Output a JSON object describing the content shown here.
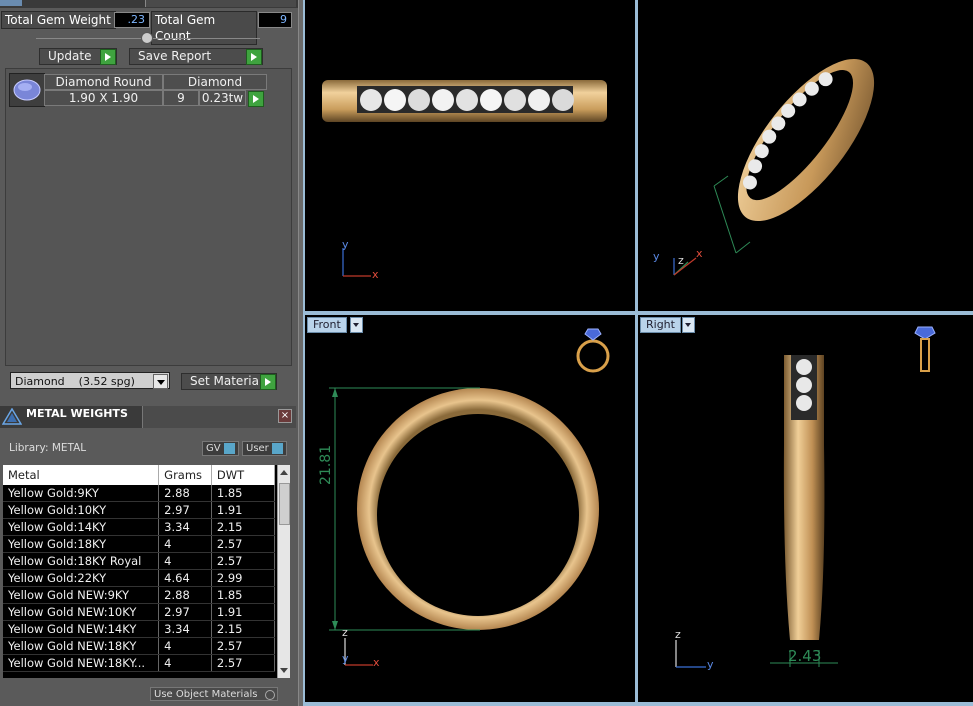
{
  "summary": {
    "gem_weight_label": "Total Gem Weight",
    "gem_weight_value": ".23",
    "gem_count_label": "Total Gem Count",
    "gem_count_value": "9"
  },
  "actions": {
    "update_label": "Update",
    "save_report_label": "Save Report"
  },
  "gem_list": {
    "shape": "Diamond Round",
    "size": "1.90 X 1.90",
    "type": "Diamond",
    "count": "9",
    "weight": "0.23tw"
  },
  "material": {
    "selected": "Diamond    (3.52 spg)",
    "set_label": "Set Material"
  },
  "metal_weights": {
    "title": "METAL WEIGHTS",
    "library_label": "Library: METAL",
    "gv_label": "GV",
    "user_label": "User",
    "columns": [
      "Metal",
      "Grams",
      "DWT"
    ],
    "rows": [
      [
        "Yellow Gold:9KY",
        "2.88",
        "1.85"
      ],
      [
        "Yellow Gold:10KY",
        "2.97",
        "1.91"
      ],
      [
        "Yellow Gold:14KY",
        "3.34",
        "2.15"
      ],
      [
        "Yellow Gold:18KY",
        "4",
        "2.57"
      ],
      [
        "Yellow Gold:18KY Royal",
        "4",
        "2.57"
      ],
      [
        "Yellow Gold:22KY",
        "4.64",
        "2.99"
      ],
      [
        "Yellow Gold NEW:9KY",
        "2.88",
        "1.85"
      ],
      [
        "Yellow Gold NEW:10KY",
        "2.97",
        "1.91"
      ],
      [
        "Yellow Gold NEW:14KY",
        "3.34",
        "2.15"
      ],
      [
        "Yellow Gold NEW:18KY",
        "4",
        "2.57"
      ],
      [
        "Yellow Gold NEW:18KY...",
        "4",
        "2.57"
      ]
    ],
    "use_object_label": "Use Object Materials"
  },
  "viewports": {
    "front_label": "Front",
    "right_label": "Right",
    "front_dimension": "21.81",
    "right_dimension": "2.43",
    "axis_x": "x",
    "axis_y": "y",
    "axis_z": "z"
  },
  "colors": {
    "gold": "#d9b27a",
    "dimension_green": "#2e8b57",
    "viewport_border": "#9bbcd6",
    "panel_bg": "#5a5a5a"
  }
}
